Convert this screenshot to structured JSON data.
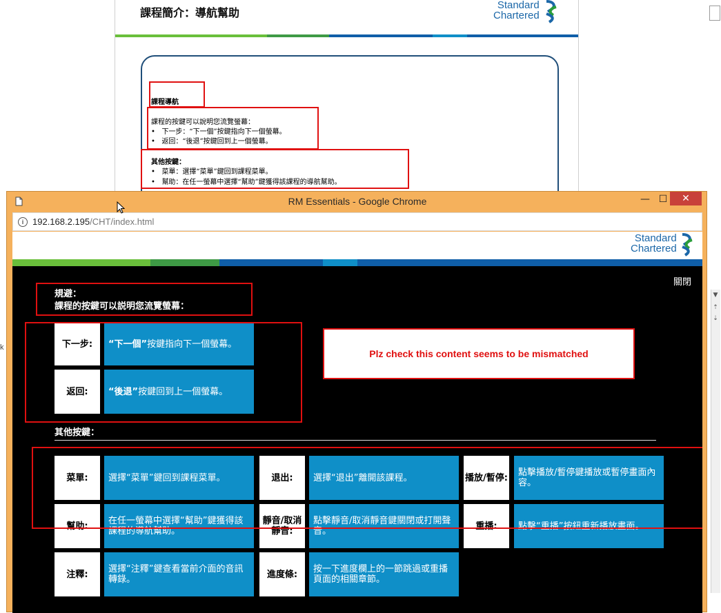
{
  "background_doc": {
    "title": "課程簡介：導航幫助",
    "logo_line1": "Standard",
    "logo_line2": "Chartered",
    "nav_heading": "課程導航",
    "nav_intro": "課程的按鍵可以說明您流覽螢幕：",
    "nav_items": [
      "下一步：“下一個”按鍵指向下一個螢幕。",
      "返回：“後退”按鍵回到上一個螢幕。"
    ],
    "other_heading": "其他按鍵：",
    "other_items": [
      "菜單：選擇“菜單”鍵回到課程菜單。",
      "幫助：在任一螢幕中選擇“幫助”鍵獲得該課程的導航幫助。"
    ]
  },
  "window": {
    "title": "RM Essentials - Google Chrome",
    "minimize": "—",
    "maximize": "☐",
    "close": "✕"
  },
  "address_bar": {
    "host": "192.168.2.195",
    "path": "/CHT/index.html",
    "info_icon": "i"
  },
  "page": {
    "logo_line1": "Standard",
    "logo_line2": "Chartered",
    "close_link": "關閉",
    "intro_title": "規避：",
    "intro_text": "課程的按鍵可以説明您流覽螢幕：",
    "nav_buttons": [
      {
        "label": "下一步:",
        "desc_bold": "“下一個”",
        "desc_rest": "按鍵指向下一個螢幕。"
      },
      {
        "label": "返回:",
        "desc_bold": "“後退”",
        "desc_rest": "按鍵回到上一個螢幕。"
      }
    ],
    "other_heading": "其他按鍵：",
    "other_buttons": [
      {
        "label": "菜單:",
        "desc": "選擇“菜單”鍵回到課程菜單。"
      },
      {
        "label": "退出:",
        "desc": "選擇“退出”離開該課程。"
      },
      {
        "label": "播放/暫停:",
        "desc": "點擊播放/暫停鍵播放或暫停畫面內容。"
      },
      {
        "label": "幫助:",
        "desc": "在任一螢幕中選擇“幫助”鍵獲得該課程的導航幫助。"
      },
      {
        "label": "靜音/取消靜音:",
        "desc": "點擊靜音/取消靜音鍵關閉或打開聲音。"
      },
      {
        "label": "重播:",
        "desc": "點擊“重播”按鈕重新播放畫面。"
      },
      {
        "label": "注釋:",
        "desc": "選擇“注釋”鍵查看當前介面的音訊轉錄。"
      },
      {
        "label": "進度條:",
        "desc": "按一下進度欄上的一節跳過或重播頁面的相關章節。"
      }
    ],
    "review_note": "Plz check this content seems to be mismatched"
  },
  "colors": {
    "accent_blue": "#0f8fc8",
    "annotation_red": "#e01010",
    "window_frame": "#f5b15c",
    "close_red": "#c8413a",
    "brand_green": "#6abf3b",
    "brand_blue": "#0f5ea8"
  }
}
